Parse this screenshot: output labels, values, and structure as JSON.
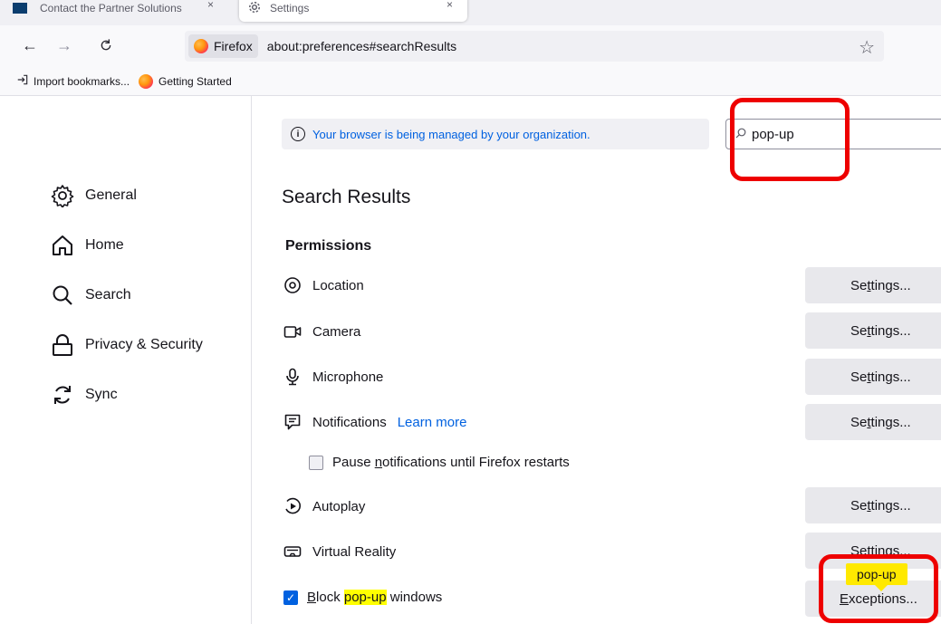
{
  "tabs": [
    {
      "title": "Contact the Partner Solutions",
      "close": "×"
    },
    {
      "title": "Settings",
      "close": "×"
    }
  ],
  "nav": {
    "back": "←",
    "forward": "→",
    "reload": "C",
    "identity_label": "Firefox",
    "url": "about:preferences#searchResults",
    "bookmark_star": "☆"
  },
  "bookmarks": {
    "import_label": "Import bookmarks...",
    "getting_started_label": "Getting Started"
  },
  "sidebar": {
    "items": [
      {
        "label": "General",
        "icon": "gear-icon"
      },
      {
        "label": "Home",
        "icon": "home-icon"
      },
      {
        "label": "Search",
        "icon": "search-icon"
      },
      {
        "label": "Privacy & Security",
        "icon": "lock-icon"
      },
      {
        "label": "Sync",
        "icon": "sync-icon"
      }
    ]
  },
  "main": {
    "policy_banner": "Your browser is being managed by your organization.",
    "search_value": "pop-up",
    "title": "Search Results",
    "section": "Permissions",
    "permissions": [
      {
        "label": "Location",
        "icon": "location-icon"
      },
      {
        "label": "Camera",
        "icon": "camera-icon"
      },
      {
        "label": "Microphone",
        "icon": "microphone-icon"
      },
      {
        "label": "Notifications",
        "icon": "notifications-icon",
        "link": "Learn more"
      },
      {
        "label": "Autoplay",
        "icon": "autoplay-icon"
      },
      {
        "label": "Virtual Reality",
        "icon": "vr-icon"
      }
    ],
    "settings_btn": {
      "pre": "Se",
      "ul": "t",
      "post": "tings..."
    },
    "pause_notifications": {
      "pre": "Pause ",
      "ul": "n",
      "post": "otifications until Firefox restarts"
    },
    "block_popups": {
      "ul": "B",
      "pre": "lock ",
      "hl": "pop-up",
      "post": " windows"
    },
    "exceptions_btn": {
      "ul": "E",
      "post": "xceptions..."
    },
    "tooltip": "pop-up"
  },
  "colors": {
    "accent": "#0061e0",
    "highlight": "#ffff00",
    "annotation": "#ee0000"
  }
}
